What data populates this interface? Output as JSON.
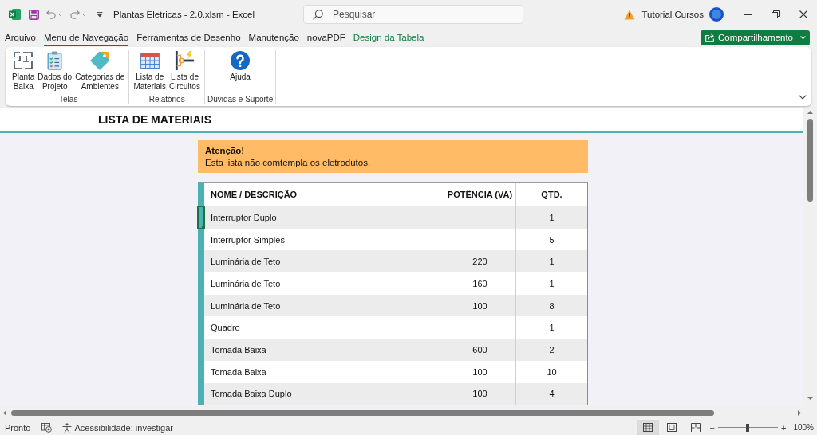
{
  "title_bar": {
    "title": "Plantas Eletricas - 2.0.xlsm - Excel",
    "search": {
      "placeholder": "Pesquisar"
    },
    "account": "Tutorial Cursos"
  },
  "ribbon_tabs": [
    {
      "label": "Arquivo",
      "selected": false,
      "kind": "normal"
    },
    {
      "label": "Menu de Navegação",
      "selected": true,
      "kind": "normal"
    },
    {
      "label": "Ferramentas de Desenho",
      "selected": false,
      "kind": "normal"
    },
    {
      "label": "Manutenção",
      "selected": false,
      "kind": "normal"
    },
    {
      "label": "novaPDF",
      "selected": false,
      "kind": "normal"
    },
    {
      "label": "Design da Tabela",
      "selected": false,
      "kind": "contextual"
    }
  ],
  "share_button": {
    "label": "Compartilhamento"
  },
  "ribbon_groups": [
    {
      "label": "Telas",
      "buttons": [
        {
          "label": "Planta\nBaixa",
          "kind": "floor-plan"
        },
        {
          "label": "Dados do\nProjeto",
          "kind": "clipboard"
        },
        {
          "label": "Categorias de\nAmbientes",
          "kind": "tag"
        }
      ]
    },
    {
      "label": "Relatórios",
      "buttons": [
        {
          "label": "Lista de\nMateriais",
          "kind": "table"
        },
        {
          "label": "Lista de\nCircuitos",
          "kind": "circuit"
        }
      ]
    },
    {
      "label": "Dúvidas e Suporte",
      "buttons": [
        {
          "label": "Ajuda",
          "kind": "help"
        }
      ]
    }
  ],
  "sheet": {
    "title": "LISTA DE MATERIAIS",
    "notice": {
      "heading": "Atenção!",
      "text": "Esta lista não comtempla os eletrodutos."
    },
    "table": {
      "columns": [
        "NOME / DESCRIÇÃO",
        "POTÊNCIA (VA)",
        "QTD."
      ],
      "rows": [
        {
          "name": "Interruptor Duplo",
          "qty": "1",
          "active": true
        },
        {
          "name": "Interruptor Simples",
          "qty": "5",
          "active": false
        },
        {
          "name": "Luminária de Teto",
          "power": "220",
          "qty": "1",
          "active": false
        },
        {
          "name": "Luminária de Teto",
          "power": "160",
          "qty": "1",
          "active": false
        },
        {
          "name": "Luminária de Teto",
          "power": "100",
          "qty": "8",
          "active": false
        },
        {
          "name": "Quadro",
          "qty": "1",
          "active": false
        },
        {
          "name": "Tomada Baixa",
          "power": "600",
          "qty": "2",
          "active": false
        },
        {
          "name": "Tomada Baixa",
          "power": "100",
          "qty": "10",
          "active": false
        },
        {
          "name": "Tomada Baixa Duplo",
          "power": "100",
          "qty": "4",
          "active": false
        }
      ]
    }
  },
  "status_bar": {
    "status": "Pronto",
    "accessibility": "Acessibilidade: investigar",
    "views": [
      {
        "kind": "normal",
        "selected": true
      },
      {
        "kind": "page-layout",
        "selected": false
      },
      {
        "kind": "page-break",
        "selected": false
      }
    ],
    "zoom": {
      "minus": "−",
      "plus": "+",
      "level": 0.5,
      "reading": "100%"
    }
  }
}
